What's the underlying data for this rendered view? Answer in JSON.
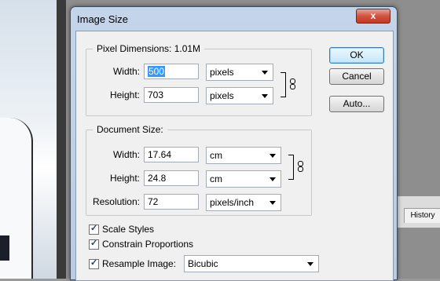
{
  "dialog": {
    "title": "Image Size",
    "close_label": "x"
  },
  "pixel_dimensions": {
    "legend": "Pixel Dimensions:  1.01M",
    "width_label": "Width:",
    "width_value": "500",
    "width_unit": "pixels",
    "height_label": "Height:",
    "height_value": "703",
    "height_unit": "pixels"
  },
  "document_size": {
    "legend": "Document Size:",
    "width_label": "Width:",
    "width_value": "17.64",
    "width_unit": "cm",
    "height_label": "Height:",
    "height_value": "24.8",
    "height_unit": "cm",
    "resolution_label": "Resolution:",
    "resolution_value": "72",
    "resolution_unit": "pixels/inch"
  },
  "options": {
    "scale_styles": {
      "label": "Scale Styles",
      "checked": true
    },
    "constrain_proportions": {
      "label": "Constrain Proportions",
      "checked": true
    },
    "resample_image": {
      "label": "Resample Image:",
      "checked": true,
      "method": "Bicubic"
    }
  },
  "buttons": {
    "ok": "OK",
    "cancel": "Cancel",
    "auto": "Auto..."
  },
  "background": {
    "history_tab": "History"
  }
}
